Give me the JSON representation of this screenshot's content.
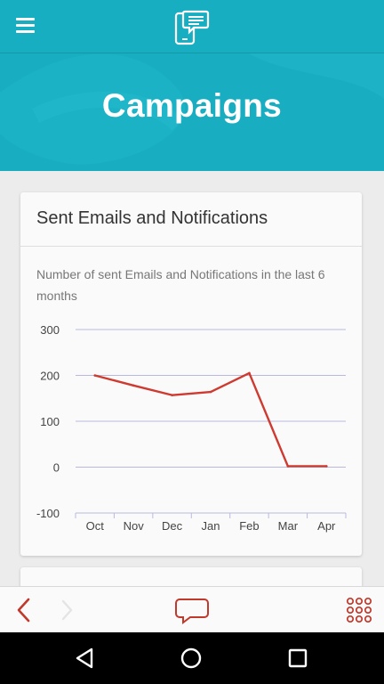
{
  "header": {
    "menu_icon": "hamburger-menu-icon",
    "logo_icon": "phone-chat-logo-icon"
  },
  "hero": {
    "title": "Campaigns"
  },
  "card": {
    "title": "Sent Emails and Notifications",
    "description": "Number of sent Emails and Notifications in the last 6 months"
  },
  "chart_data": {
    "type": "line",
    "categories": [
      "Oct",
      "Nov",
      "Dec",
      "Jan",
      "Feb",
      "Mar",
      "Apr"
    ],
    "series": [
      {
        "values": [
          200,
          178,
          157,
          164,
          205,
          2,
          2
        ],
        "color": "#cf3a30"
      }
    ],
    "yticks": [
      300,
      200,
      100,
      0,
      -100
    ],
    "ylim": [
      -100,
      300
    ],
    "grid": true,
    "title": "",
    "xlabel": "",
    "ylabel": ""
  },
  "toolbar": {
    "back_icon": "chevron-left-icon",
    "forward_icon": "chevron-right-icon",
    "chat_icon": "speech-bubble-icon",
    "apps_icon": "grid-dots-icon",
    "accent": "#c0392b"
  },
  "system_nav": {
    "back_icon": "triangle-back-icon",
    "home_icon": "circle-home-icon",
    "recents_icon": "square-recents-icon"
  },
  "colors": {
    "primary": "#18aec2",
    "line": "#cf3a30",
    "grid": "#b9b9e0"
  }
}
